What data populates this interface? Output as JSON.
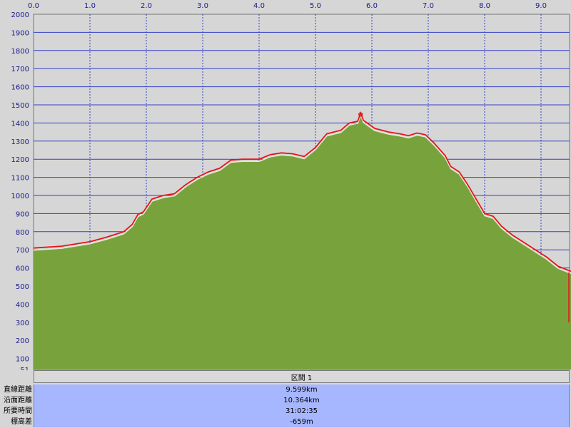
{
  "chart_data": {
    "type": "area",
    "x_ticks": [
      "0.0",
      "1.0",
      "2.0",
      "3.0",
      "4.0",
      "5.0",
      "6.0",
      "7.0",
      "8.0",
      "9.0"
    ],
    "y_ticks": [
      "2000",
      "1900",
      "1800",
      "1700",
      "1600",
      "1500",
      "1400",
      "1300",
      "1200",
      "1100",
      "1000",
      "900",
      "800",
      "700",
      "600",
      "500",
      "400",
      "300",
      "200",
      "100",
      "51"
    ],
    "xlim": [
      0,
      9.6
    ],
    "ylim": [
      51,
      2000
    ],
    "grid": true,
    "colors": {
      "fill": "#78a33c",
      "route_line": "#e8141c",
      "grid": "#3340c8",
      "background": "#d6d6d6"
    },
    "series": [
      {
        "name": "route",
        "points": [
          [
            0.0,
            710
          ],
          [
            0.5,
            720
          ],
          [
            1.0,
            745
          ],
          [
            1.3,
            770
          ],
          [
            1.6,
            800
          ],
          [
            1.75,
            840
          ],
          [
            1.85,
            895
          ],
          [
            1.95,
            910
          ],
          [
            2.1,
            980
          ],
          [
            2.3,
            1000
          ],
          [
            2.5,
            1010
          ],
          [
            2.7,
            1060
          ],
          [
            2.9,
            1100
          ],
          [
            3.1,
            1130
          ],
          [
            3.3,
            1150
          ],
          [
            3.5,
            1195
          ],
          [
            3.7,
            1200
          ],
          [
            4.0,
            1200
          ],
          [
            4.2,
            1225
          ],
          [
            4.4,
            1235
          ],
          [
            4.6,
            1230
          ],
          [
            4.8,
            1215
          ],
          [
            5.0,
            1265
          ],
          [
            5.2,
            1340
          ],
          [
            5.45,
            1360
          ],
          [
            5.6,
            1400
          ],
          [
            5.75,
            1410
          ],
          [
            5.8,
            1455
          ],
          [
            5.85,
            1415
          ],
          [
            6.05,
            1370
          ],
          [
            6.3,
            1350
          ],
          [
            6.5,
            1340
          ],
          [
            6.65,
            1330
          ],
          [
            6.8,
            1345
          ],
          [
            6.95,
            1335
          ],
          [
            7.1,
            1290
          ],
          [
            7.3,
            1220
          ],
          [
            7.4,
            1160
          ],
          [
            7.55,
            1130
          ],
          [
            7.7,
            1060
          ],
          [
            7.85,
            980
          ],
          [
            8.0,
            900
          ],
          [
            8.15,
            885
          ],
          [
            8.3,
            830
          ],
          [
            8.5,
            780
          ],
          [
            8.7,
            740
          ],
          [
            8.9,
            700
          ],
          [
            9.1,
            660
          ],
          [
            9.3,
            610
          ],
          [
            9.5,
            585
          ],
          [
            9.6,
            575
          ]
        ]
      }
    ]
  },
  "section": {
    "title": "区間 1"
  },
  "stats": [
    {
      "label": "直線距離",
      "value": "9.599km"
    },
    {
      "label": "沿面距離",
      "value": "10.364km"
    },
    {
      "label": "所要時間",
      "value": "31:02:35"
    },
    {
      "label": "標高差",
      "value": "-659m"
    }
  ]
}
